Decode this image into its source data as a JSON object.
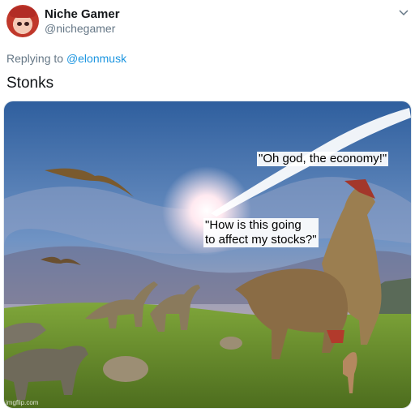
{
  "tweet": {
    "author_name": "Niche Gamer",
    "author_handle": "@nichegamer",
    "reply_prefix": "Replying to",
    "reply_mention": "@elonmusk",
    "text": "Stonks"
  },
  "meme": {
    "caption_trex": "\"Oh god, the economy!\"",
    "caption_meteor_line1": "\"How is this going",
    "caption_meteor_line2": "to affect my stocks?\"",
    "watermark": "imgflip.com"
  },
  "icons": {
    "menu": "chevron-down-icon",
    "avatar": "avatar"
  },
  "colors": {
    "name": "#14171a",
    "secondary": "#657786",
    "mention": "#1b95e0"
  }
}
